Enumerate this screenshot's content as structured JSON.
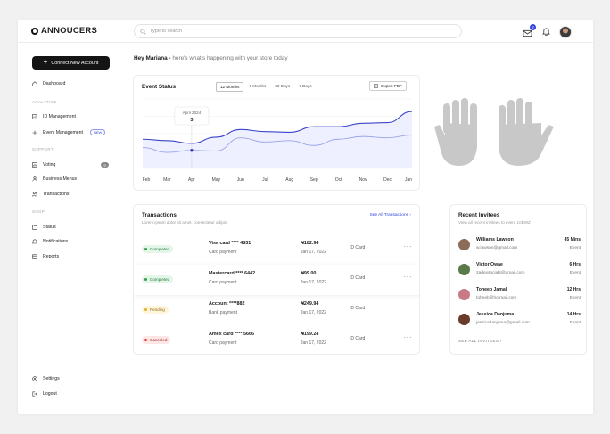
{
  "app": {
    "brand": "ANNOUCERS"
  },
  "search": {
    "placeholder": "Type to search"
  },
  "header": {
    "message_count": "2"
  },
  "sidebar": {
    "connect_label": "Connect New Account",
    "dashboard": "Dashboard",
    "section_analytics": "ANALYTICS",
    "id_management": "ID Management",
    "event_management": "Event Management",
    "new_badge": "NEW",
    "section_support": "SUPPORT",
    "voting": "Voting",
    "voting_count": "9",
    "business_menus": "Business Menus",
    "transactions": "Transactions",
    "section_shop": "SHOP",
    "status": "Status",
    "notifications": "Notifications",
    "reports": "Reports",
    "settings": "Settings",
    "logout": "Logout"
  },
  "greeting": {
    "name": "Hey Mariana -",
    "subtitle": " here's what's happening with your store today"
  },
  "event_status": {
    "title": "Event Status",
    "filters": [
      "12 Months",
      "6 Months",
      "30 Days",
      "7 Days"
    ],
    "export_label": "Export PDF",
    "tooltip_date": "April 2024",
    "tooltip_value": "3"
  },
  "chart_data": {
    "type": "line",
    "categories": [
      "Feb",
      "Mar",
      "Apr",
      "May",
      "Jun",
      "Jul",
      "Aug",
      "Sep",
      "Oct",
      "Nov",
      "Dec",
      "Jan"
    ],
    "series": [
      {
        "values": [
          42,
          40,
          36,
          45,
          56,
          53,
          52,
          60,
          60,
          65,
          66,
          82
        ]
      },
      {
        "values": [
          30,
          23,
          26,
          25,
          44,
          38,
          40,
          33,
          42,
          46,
          44,
          48
        ]
      }
    ],
    "highlight": {
      "category": "Apr",
      "value": 3
    },
    "grid": true,
    "colors": {
      "primary": "#3a45c8",
      "secondary": "#9aa3e8",
      "fill": "#eef0ff"
    }
  },
  "transactions": {
    "title": "Transactions",
    "subtitle": "Lorem ipsum dolor sit amet, consectetur adipis",
    "see_all": "See All Transactions",
    "rows": [
      {
        "status": "Completed",
        "status_color": "green",
        "card": "Visa card **** 4831",
        "type": "Card payment",
        "amount": "₦182.94",
        "date": "Jan 17, 2022",
        "method": "ID Card"
      },
      {
        "status": "Completed",
        "status_color": "green",
        "card": "Mastercard **** 6442",
        "type": "Card payment",
        "amount": "₦99.00",
        "date": "Jan 17, 2022",
        "method": "ID Card"
      },
      {
        "status": "Pending",
        "status_color": "yellow",
        "card": "Account ****882",
        "type": "Bank payment",
        "amount": "₦249.94",
        "date": "Jan 17, 2022",
        "method": "ID Card"
      },
      {
        "status": "Canceled",
        "status_color": "red",
        "card": "Amex card **** 5666",
        "type": "Card payment",
        "amount": "₦199.24",
        "date": "Jan 17, 2022",
        "method": "ID Card"
      }
    ]
  },
  "invitees": {
    "title": "Recent Invitees",
    "subtitle": "View all recent invitees to event 10BWZ",
    "see_all": "SEE ALL INVITEES",
    "rows": [
      {
        "name": "Williams Lawson",
        "email": "w.lawson@gmail.com",
        "time": "45 Mins",
        "kind": "Event",
        "avatar_color": "#8d6b5a"
      },
      {
        "name": "Victor Owae",
        "email": "2adexsocials@gmail.com",
        "time": "6 Hrs",
        "kind": "Event",
        "avatar_color": "#5a7a4a"
      },
      {
        "name": "Toheeb Jamal",
        "email": "toheeb@hotmail.com",
        "time": "12 Hrs",
        "kind": "Event",
        "avatar_color": "#c87b86"
      },
      {
        "name": "Jessica Danjuma",
        "email": "jessicadanjuma@gmail.com",
        "time": "14 Hrs",
        "kind": "Event",
        "avatar_color": "#6a3a2a"
      }
    ]
  }
}
